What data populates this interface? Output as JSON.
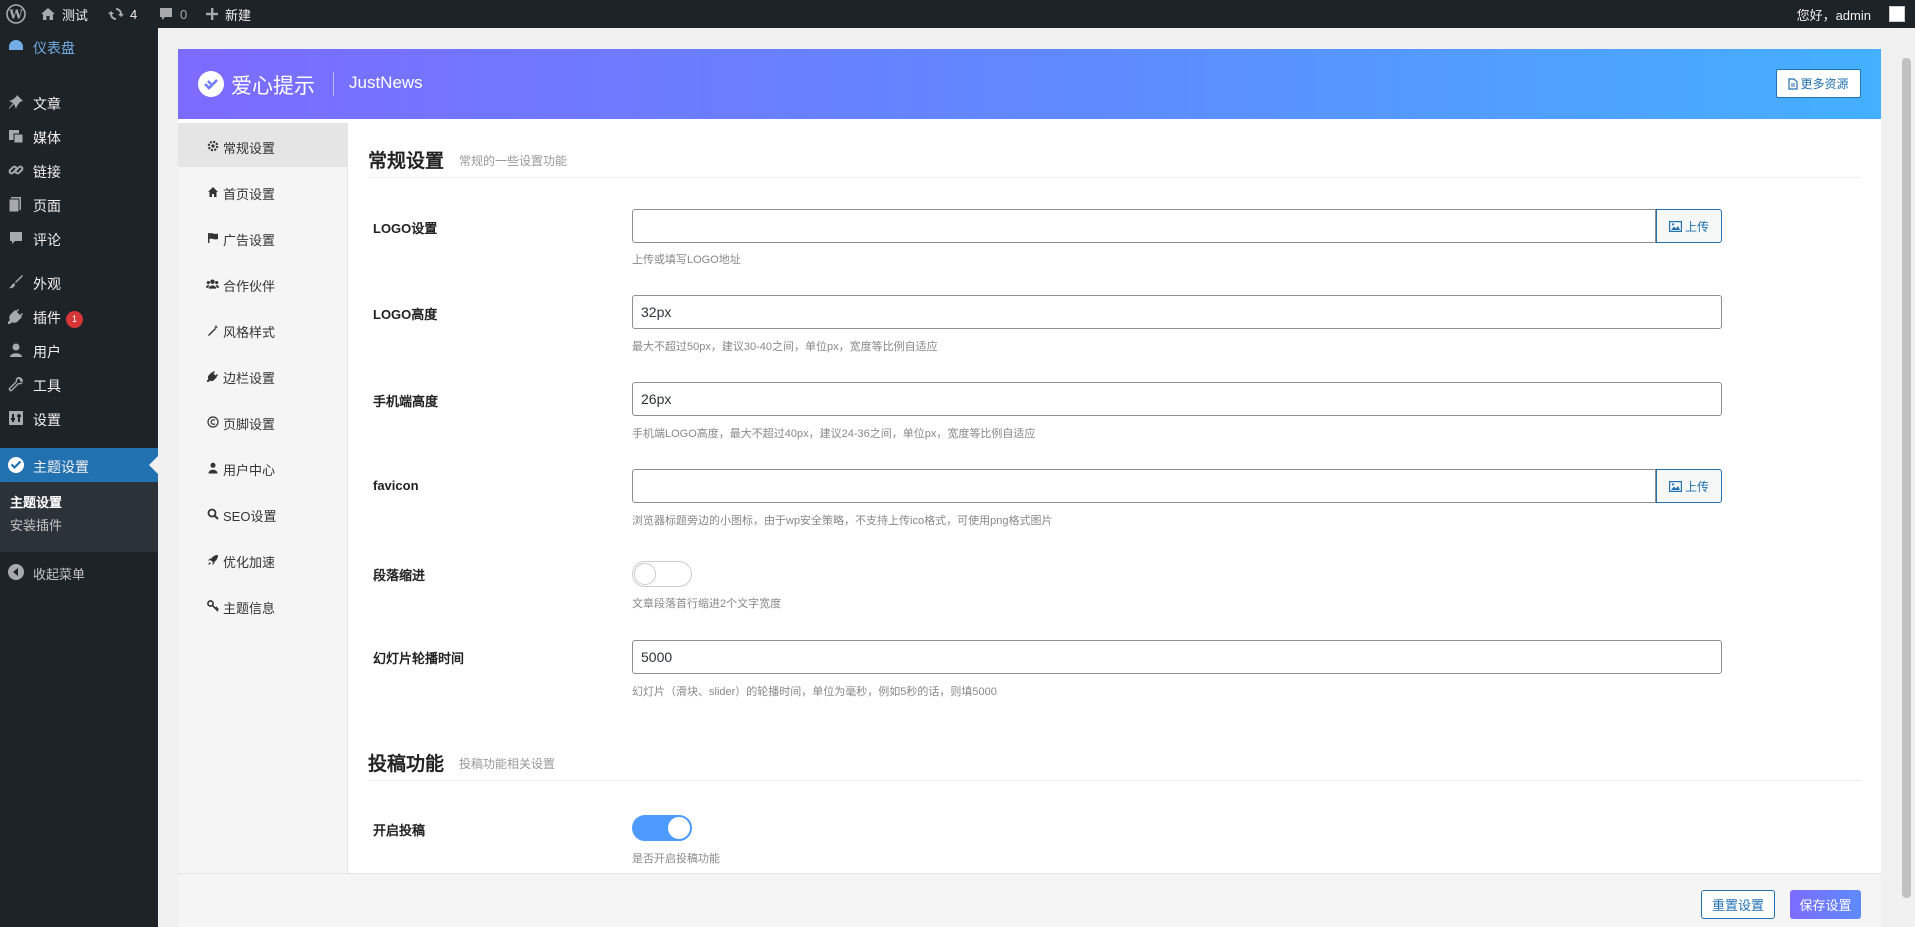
{
  "adminbar": {
    "site_name": "测试",
    "updates_count": "4",
    "comments_count": "0",
    "new_label": "新建",
    "greeting": "您好，admin"
  },
  "menu": {
    "dashboard": "仪表盘",
    "posts": "文章",
    "media": "媒体",
    "links": "链接",
    "pages": "页面",
    "comments": "评论",
    "appearance": "外观",
    "plugins": "插件",
    "plugins_badge": "1",
    "users": "用户",
    "tools": "工具",
    "settings": "设置",
    "theme_settings": "主题设置",
    "sub_theme_settings": "主题设置",
    "sub_install_plugins": "安装插件",
    "collapse": "收起菜单"
  },
  "header": {
    "logo_text": "爱心提示",
    "theme_name": "JustNews",
    "more_resources": "更多资源"
  },
  "nav": [
    {
      "label": "常规设置"
    },
    {
      "label": "首页设置"
    },
    {
      "label": "广告设置"
    },
    {
      "label": "合作伙伴"
    },
    {
      "label": "风格样式"
    },
    {
      "label": "边栏设置"
    },
    {
      "label": "页脚设置"
    },
    {
      "label": "用户中心"
    },
    {
      "label": "SEO设置"
    },
    {
      "label": "优化加速"
    },
    {
      "label": "主题信息"
    }
  ],
  "general": {
    "title": "常规设置",
    "desc": "常规的一些设置功能",
    "logo_label": "LOGO设置",
    "logo_value": "",
    "logo_help": "上传或填写LOGO地址",
    "upload_label": "上传",
    "logo_height_label": "LOGO高度",
    "logo_height_value": "32px",
    "logo_height_help": "最大不超过50px，建议30-40之间，单位px，宽度等比例自适应",
    "mobile_height_label": "手机端高度",
    "mobile_height_value": "26px",
    "mobile_height_help": "手机端LOGO高度，最大不超过40px，建议24-36之间，单位px，宽度等比例自适应",
    "favicon_label": "favicon",
    "favicon_value": "",
    "favicon_help": "浏览器标题旁边的小图标，由于wp安全策略，不支持上传ico格式，可使用png格式图片",
    "indent_label": "段落缩进",
    "indent_on": false,
    "indent_help": "文章段落首行缩进2个文字宽度",
    "slider_label": "幻灯片轮播时间",
    "slider_value": "5000",
    "slider_help": "幻灯片（滑块、slider）的轮播时间，单位为毫秒，例如5秒的话，则填5000"
  },
  "contribute": {
    "title": "投稿功能",
    "desc": "投稿功能相关设置",
    "enable_label": "开启投稿",
    "enable_on": true,
    "enable_help": "是否开启投稿功能"
  },
  "footer": {
    "reset_label": "重置设置",
    "save_label": "保存设置"
  },
  "colors": {
    "admin_dark": "#1d2327",
    "wp_blue": "#2271b1",
    "accent_purple": "#7c6bff",
    "toggle_on": "#4e9bff"
  }
}
